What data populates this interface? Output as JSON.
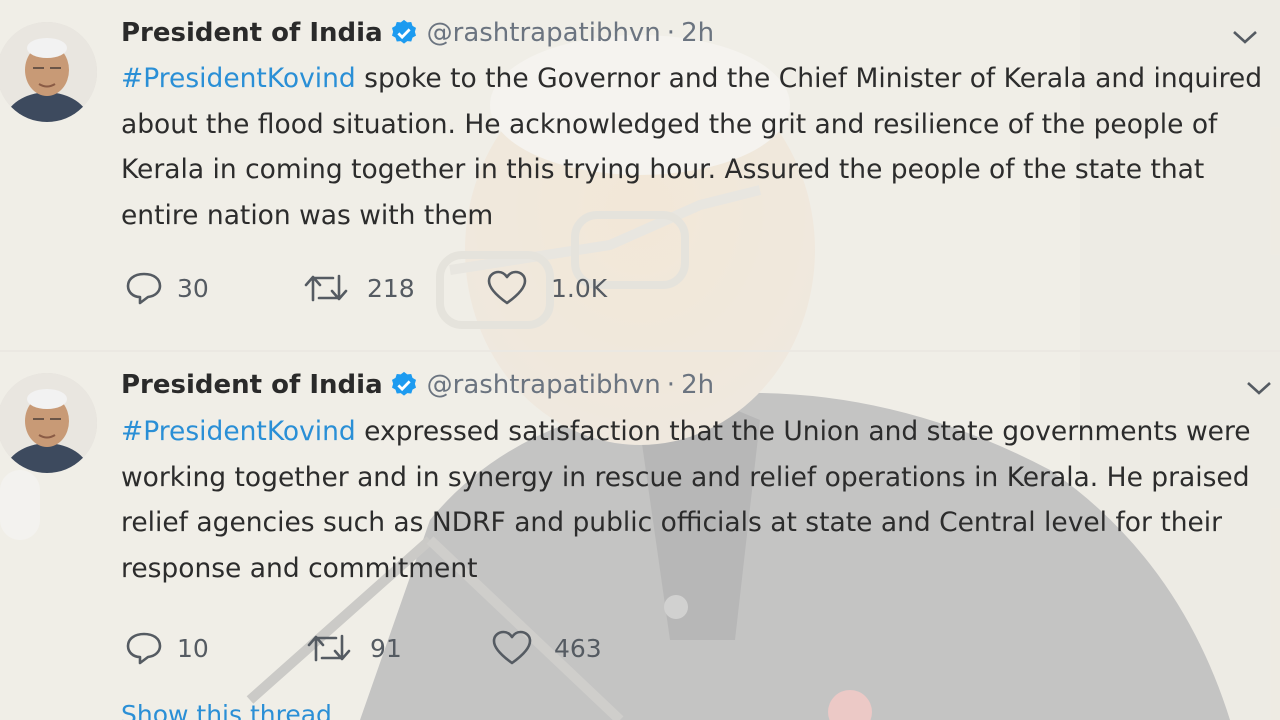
{
  "colors": {
    "accent": "#2a8fd6",
    "verified": "#1d9bf0",
    "text": "#2c2c2c",
    "muted": "#6b7480"
  },
  "tweets": [
    {
      "author": "President of India",
      "handle": "@rashtrapatibhvn",
      "separator": "·",
      "time": "2h",
      "hashtag": "#PresidentKovind",
      "text": " spoke to the Governor and the Chief Minister of Kerala and inquired about the flood situation. He acknowledged the grit and resilience of the people of Kerala in coming together in this trying hour. Assured the people of the state that entire nation was with them",
      "replies": "30",
      "retweets": "218",
      "likes": "1.0K",
      "icons": {
        "reply": "reply-icon",
        "retweet": "retweet-icon",
        "like": "heart-icon",
        "menu": "chevron-down-icon",
        "verified": "verified-badge-icon"
      }
    },
    {
      "author": "President of India",
      "handle": "@rashtrapatibhvn",
      "separator": "·",
      "time": "2h",
      "hashtag": "#PresidentKovind",
      "text": " expressed satisfaction that the Union and state governments were working together and in synergy in rescue and relief operations in Kerala. He praised relief agencies such as NDRF and public officials at state and Central level for their response and commitment",
      "replies": "10",
      "retweets": "91",
      "likes": "463",
      "thread_link": "Show this thread",
      "icons": {
        "reply": "reply-icon",
        "retweet": "retweet-icon",
        "like": "heart-icon",
        "menu": "chevron-down-icon",
        "verified": "verified-badge-icon"
      }
    }
  ]
}
